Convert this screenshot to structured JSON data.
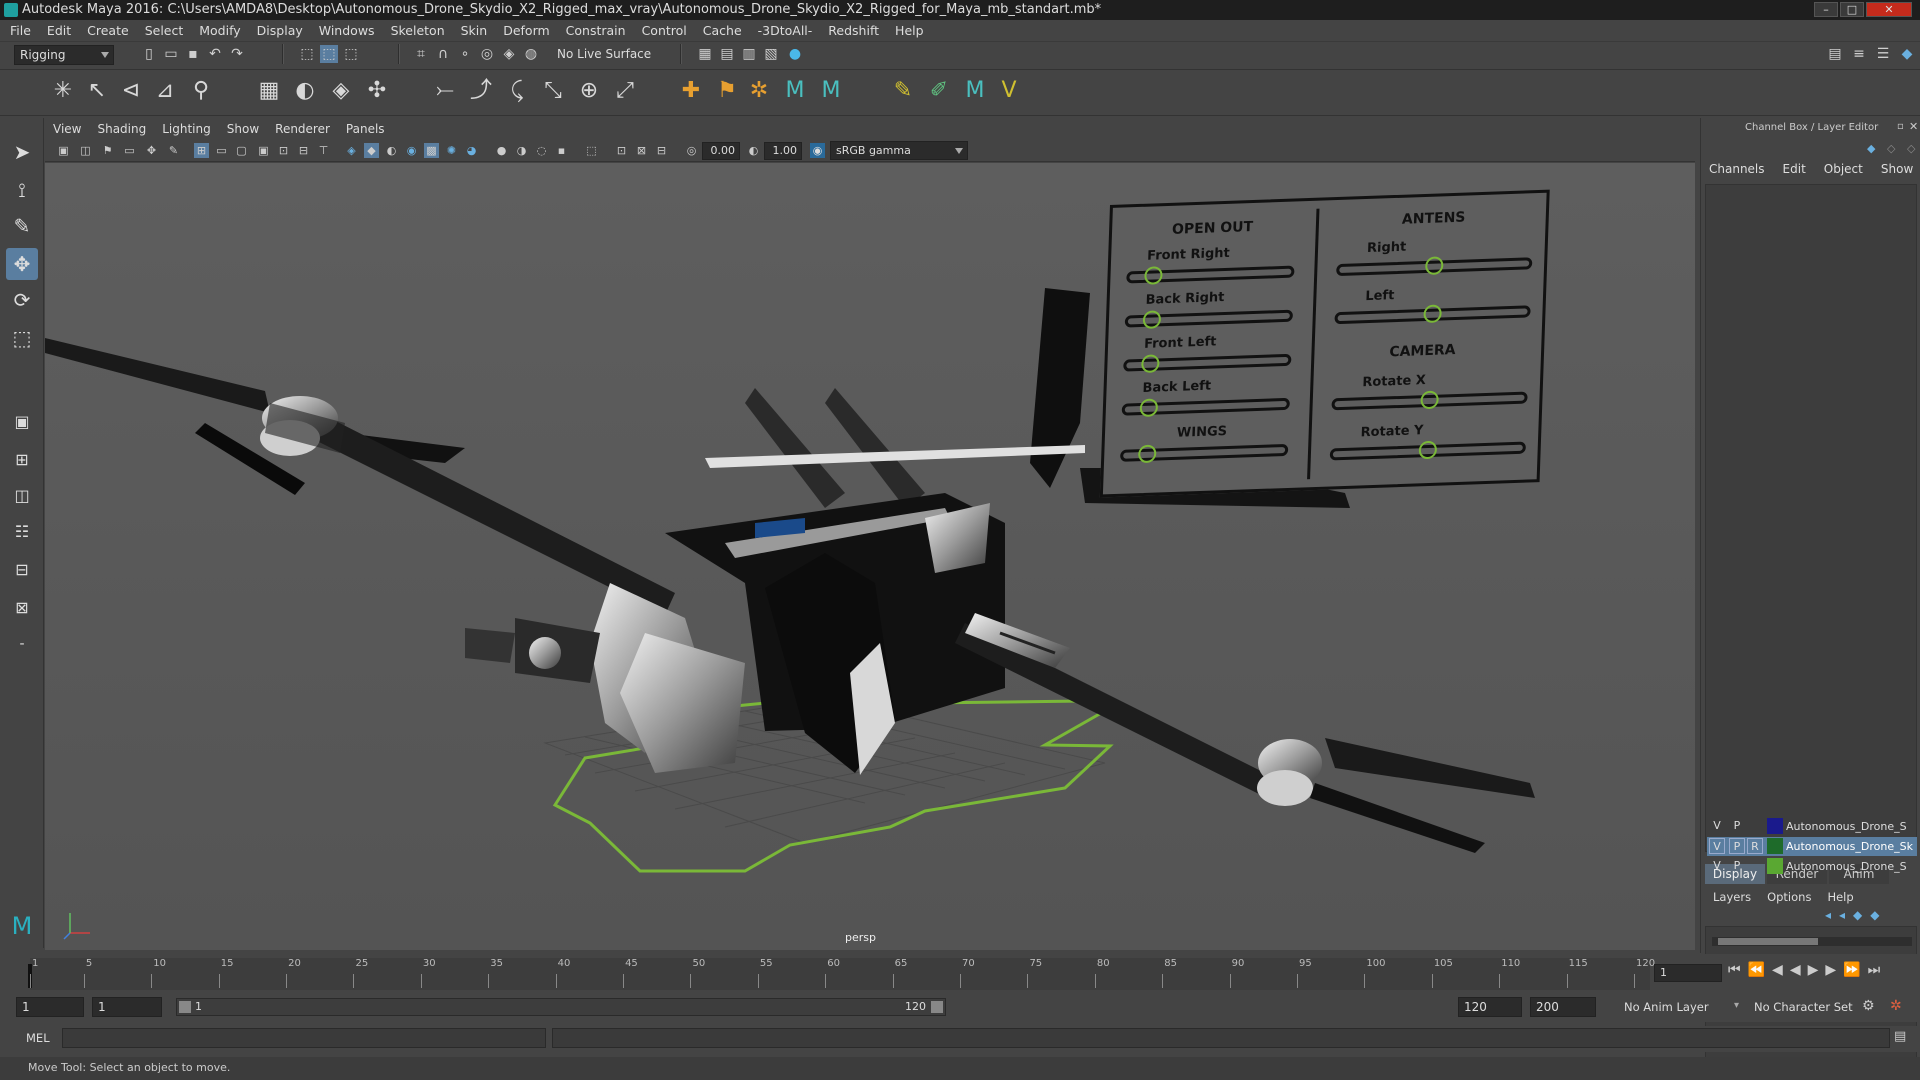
{
  "window": {
    "title": "Autodesk Maya 2016: C:\\Users\\AMDA8\\Desktop\\Autonomous_Drone_Skydio_X2_Rigged_max_vray\\Autonomous_Drone_Skydio_X2_Rigged_for_Maya_mb_standart.mb*",
    "minimize": "–",
    "maximize": "□",
    "close": "✕"
  },
  "menubar": [
    "File",
    "Edit",
    "Create",
    "Select",
    "Modify",
    "Display",
    "Windows",
    "Skeleton",
    "Skin",
    "Deform",
    "Constrain",
    "Control",
    "Cache",
    "-3DtoAll-",
    "Redshift",
    "Help"
  ],
  "shelf": {
    "menuset": "Rigging",
    "live_surface": "No Live Surface"
  },
  "panel": {
    "menus": [
      "View",
      "Shading",
      "Lighting",
      "Show",
      "Renderer",
      "Panels"
    ],
    "exposure": "0.00",
    "gamma": "1.00",
    "colorspace": "sRGB gamma",
    "camera_label": "persp"
  },
  "rig_panel": {
    "open_out": "OPEN OUT",
    "front_right": "Front Right",
    "back_right": "Back Right",
    "front_left": "Front Left",
    "back_left": "Back Left",
    "wings": "WINGS",
    "antens": "ANTENS",
    "right": "Right",
    "left": "Left",
    "camera": "CAMERA",
    "rotate_x": "Rotate X",
    "rotate_y": "Rotate Y"
  },
  "channelbox": {
    "title": "Channel Box / Layer Editor",
    "menus": [
      "Channels",
      "Edit",
      "Object",
      "Show"
    ],
    "tabs": [
      "Display",
      "Render",
      "Anim"
    ],
    "layer_menus": [
      "Layers",
      "Options",
      "Help"
    ],
    "layers": [
      {
        "v": "V",
        "p": "P",
        "r": "",
        "name": "Autonomous_Drone_S",
        "color": "#1a1a8c",
        "selected": false
      },
      {
        "v": "V",
        "p": "P",
        "r": "R",
        "name": "Autonomous_Drone_Sk",
        "color": "#1e6b2a",
        "selected": true
      },
      {
        "v": "V",
        "p": "P",
        "r": "",
        "name": "Autonomous_Drone_S",
        "color": "#5aa832",
        "selected": false
      }
    ]
  },
  "timeline": {
    "ticks": [
      "1",
      "5",
      "10",
      "15",
      "20",
      "25",
      "30",
      "35",
      "40",
      "45",
      "50",
      "55",
      "60",
      "65",
      "70",
      "75",
      "80",
      "85",
      "90",
      "95",
      "100",
      "105",
      "110",
      "115",
      "120"
    ],
    "current_frame": "1"
  },
  "range": {
    "start": "1",
    "playback_start": "1",
    "slider_start": "1",
    "slider_end": "120",
    "playback_end": "120",
    "end": "200",
    "anim_layer": "No Anim Layer",
    "char_set": "No Character Set"
  },
  "mel": {
    "label": "MEL"
  },
  "status": "Move Tool: Select an object to move."
}
